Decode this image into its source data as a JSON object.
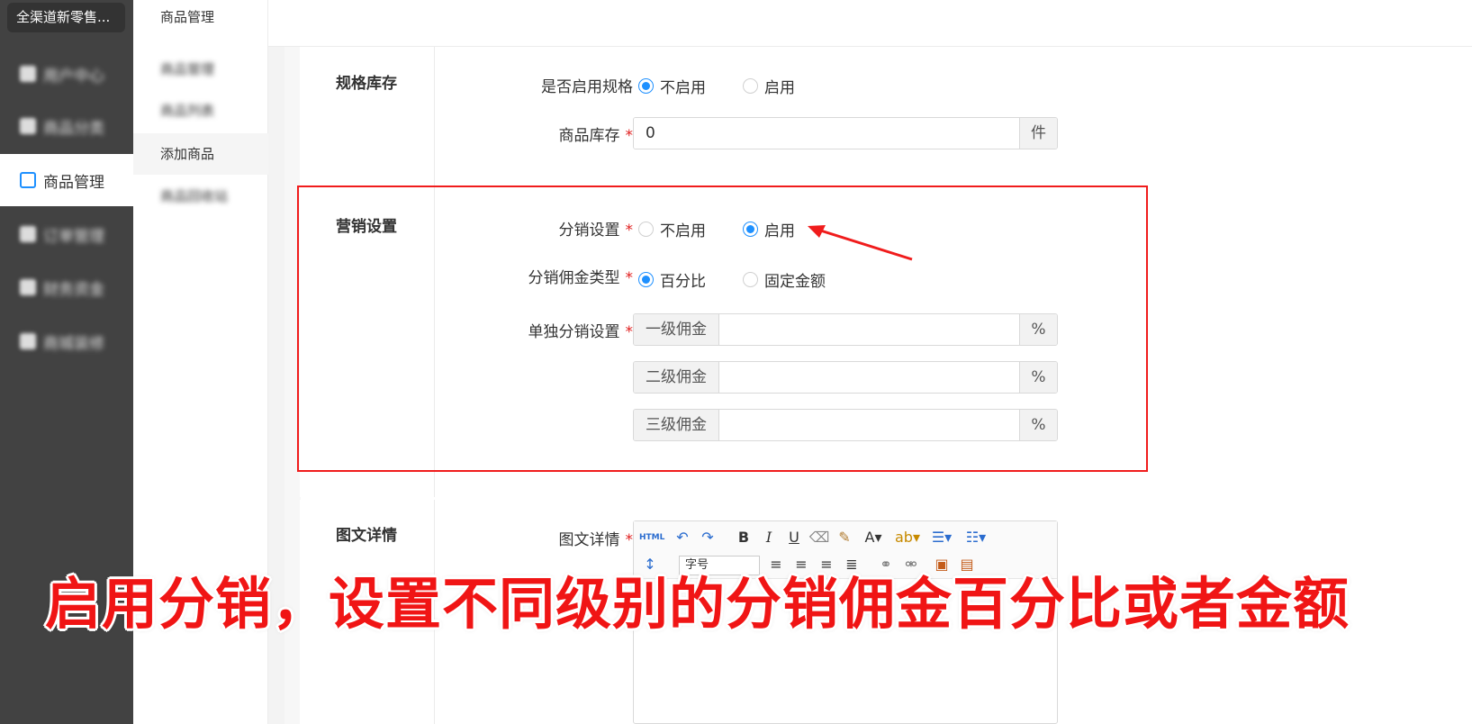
{
  "sidebar": {
    "brand": "全渠道新零售...",
    "items": [
      {
        "label": "用户中心",
        "blurred": true
      },
      {
        "label": "商品分类",
        "blurred": true
      },
      {
        "label": "商品管理",
        "blurred": false,
        "active": true
      },
      {
        "label": "订单管理",
        "blurred": true
      },
      {
        "label": "财务资金",
        "blurred": true
      },
      {
        "label": "商城装修",
        "blurred": true
      }
    ]
  },
  "submenu": {
    "title": "商品管理",
    "items": [
      {
        "label": "商品管理",
        "blurred": true
      },
      {
        "label": "商品列表",
        "blurred": true
      },
      {
        "label": "添加商品",
        "active": true
      },
      {
        "label": "商品回收站",
        "blurred": true
      }
    ]
  },
  "spec_section": {
    "title": "规格库存",
    "enable_spec_label": "是否启用规格",
    "radio_off": "不启用",
    "radio_on": "启用",
    "stock_label": "商品库存",
    "stock_value": "0",
    "stock_unit": "件",
    "required_mark": "*"
  },
  "marketing_section": {
    "title": "营销设置",
    "distribution_label": "分销设置",
    "distribution_off": "不启用",
    "distribution_on": "启用",
    "commission_type_label": "分销佣金类型",
    "commission_percent": "百分比",
    "commission_fixed": "固定金额",
    "separate_label": "单独分销设置",
    "levels": [
      {
        "label": "一级佣金",
        "unit": "%"
      },
      {
        "label": "二级佣金",
        "unit": "%"
      },
      {
        "label": "三级佣金",
        "unit": "%"
      }
    ]
  },
  "detail_section": {
    "title": "图文详情",
    "field_label": "图文详情",
    "toolbar_html": "HTML",
    "font_select": "字号"
  },
  "caption": "启用分销，设置不同级别的分销佣金百分比或者金额",
  "colors": {
    "accent": "#1e90ff",
    "highlight": "#f01c1c",
    "sidebar": "#424242"
  }
}
